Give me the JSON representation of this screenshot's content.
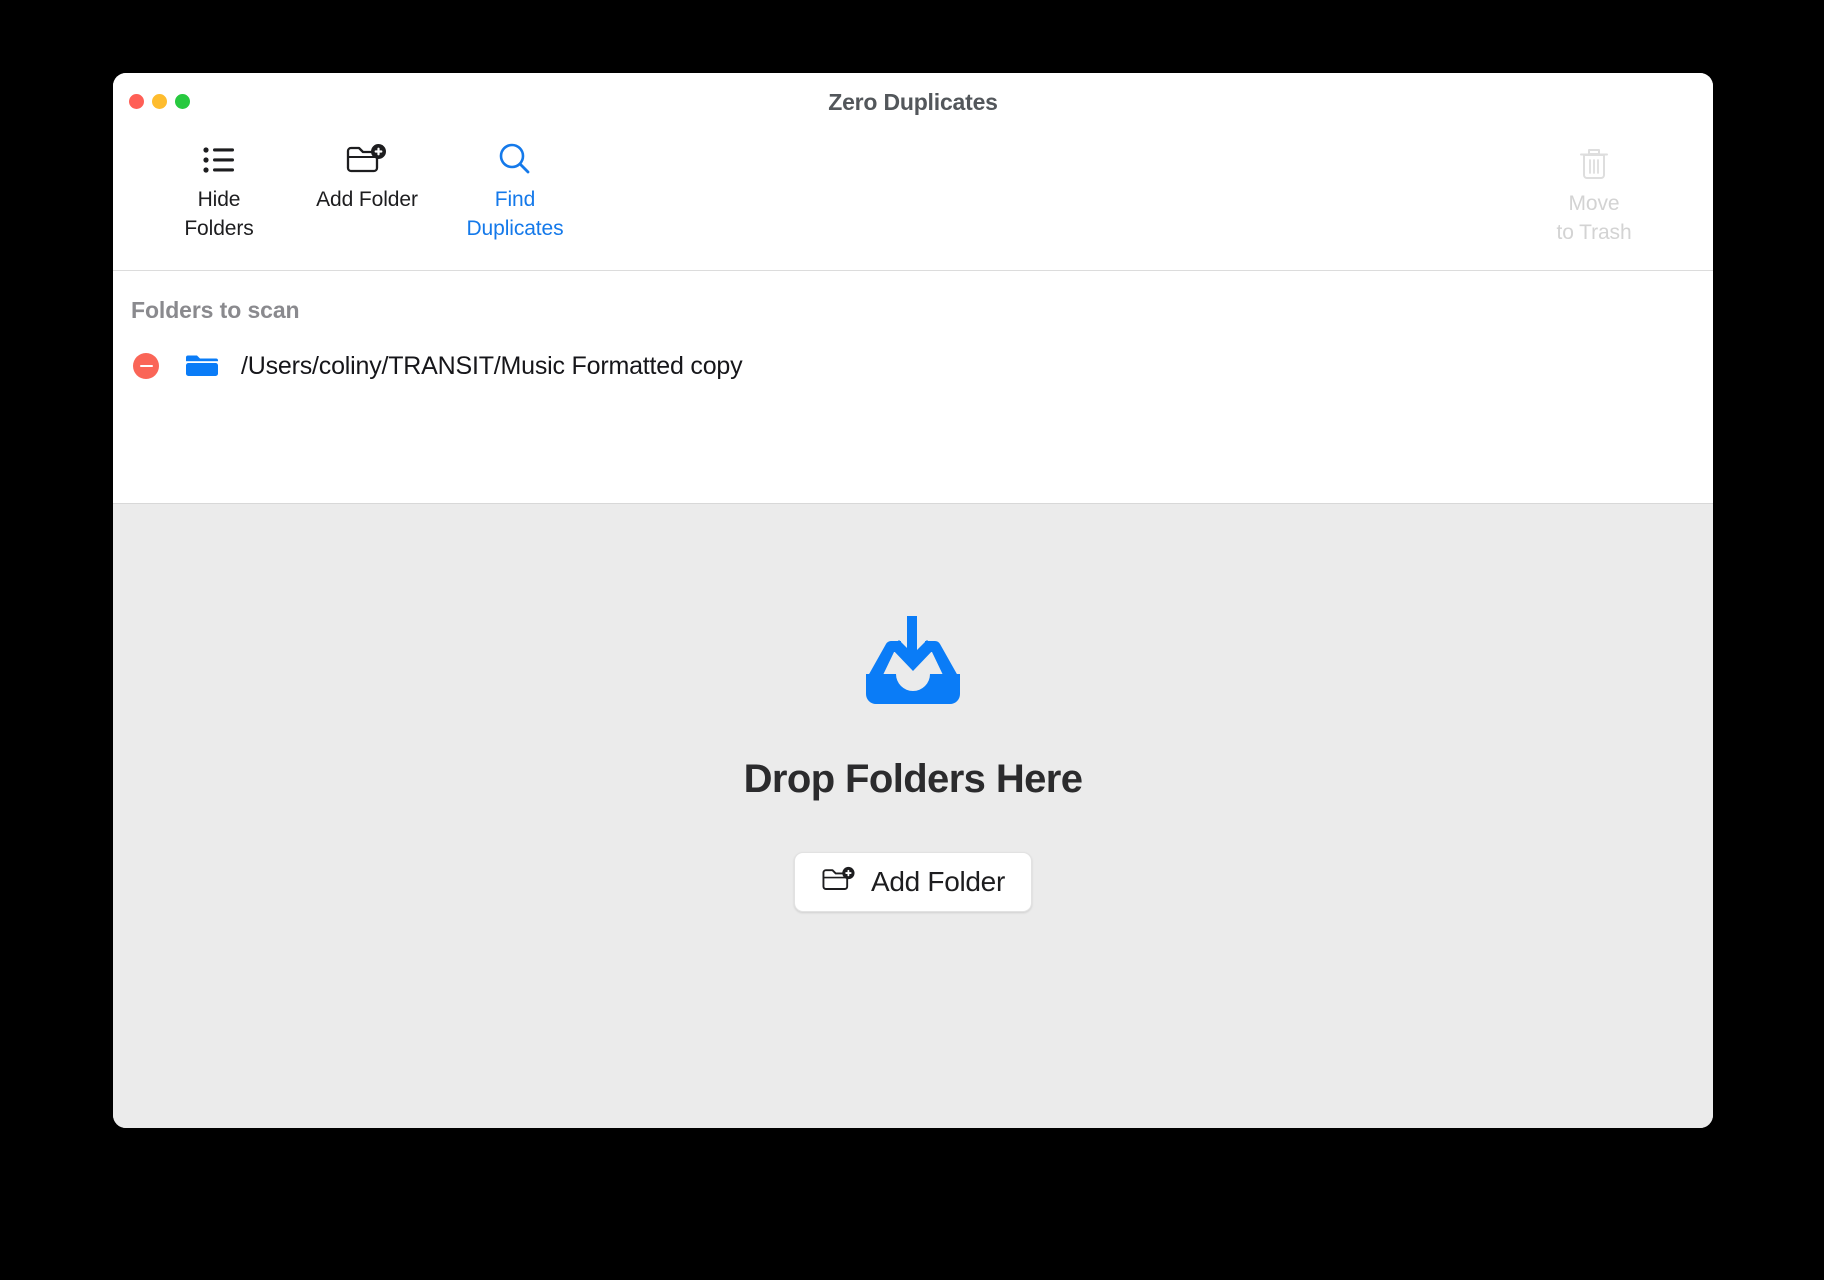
{
  "window": {
    "title": "Zero Duplicates",
    "traffic_lights": [
      {
        "name": "close",
        "color": "#ff5f56"
      },
      {
        "name": "minimize",
        "color": "#febc2e"
      },
      {
        "name": "zoom",
        "color": "#27c93f"
      }
    ]
  },
  "toolbar": {
    "items": [
      {
        "id": "hide-folders",
        "icon": "list-bullet-icon",
        "label_line1": "Hide",
        "label_line2": "Folders",
        "state": "enabled",
        "color": "#1d1d1f"
      },
      {
        "id": "add-folder",
        "icon": "folder-plus-icon",
        "label_line1": "Add Folder",
        "label_line2": "",
        "state": "enabled",
        "color": "#1d1d1f"
      },
      {
        "id": "find-duplicates",
        "icon": "magnifier-icon",
        "label_line1": "Find",
        "label_line2": "Duplicates",
        "state": "enabled",
        "color": "#1479ea"
      }
    ],
    "trash": {
      "id": "move-to-trash",
      "icon": "trash-icon",
      "label_line1": "Move",
      "label_line2": "to Trash",
      "state": "disabled",
      "color": "#d3d3d3"
    }
  },
  "folders_panel": {
    "heading": "Folders to scan",
    "rows": [
      {
        "remove_label": "remove",
        "icon": "folder-icon",
        "path": "/Users/coliny/TRANSIT/Music Formatted copy"
      }
    ]
  },
  "dropzone": {
    "icon": "tray-download-icon",
    "title": "Drop Folders Here",
    "button": {
      "icon": "folder-plus-icon",
      "label": "Add Folder"
    },
    "background": "#ebebeb"
  },
  "colors": {
    "accent": "#1479ea",
    "remove_red": "#fa6557",
    "folder_blue": "#0a7cf7",
    "drop_icon_blue": "#0a7cf7",
    "disabled_gray": "#d3d3d3",
    "heading_gray": "#8a8a8e"
  }
}
